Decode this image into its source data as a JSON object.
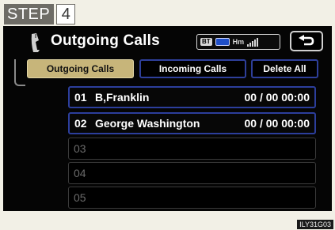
{
  "step": {
    "label": "STEP",
    "number": "4"
  },
  "header": {
    "title": "Outgoing Calls",
    "status_bt": "BT",
    "status_hm": "Hm"
  },
  "tabs": [
    {
      "label": "Outgoing Calls",
      "active": true
    },
    {
      "label": "Incoming Calls",
      "active": false
    },
    {
      "label": "Delete All",
      "active": false
    }
  ],
  "rows": [
    {
      "num": "01",
      "name": "B,Franklin",
      "time": "00 / 00 00:00"
    },
    {
      "num": "02",
      "name": "George Washington",
      "time": "00 / 00 00:00"
    },
    {
      "num": "03",
      "name": "",
      "time": ""
    },
    {
      "num": "04",
      "name": "",
      "time": ""
    },
    {
      "num": "05",
      "name": "",
      "time": ""
    }
  ],
  "image_code": "ILY31G03",
  "colors": {
    "accent_tab": "#c7b57a",
    "border_blue": "#2c3e9c"
  }
}
